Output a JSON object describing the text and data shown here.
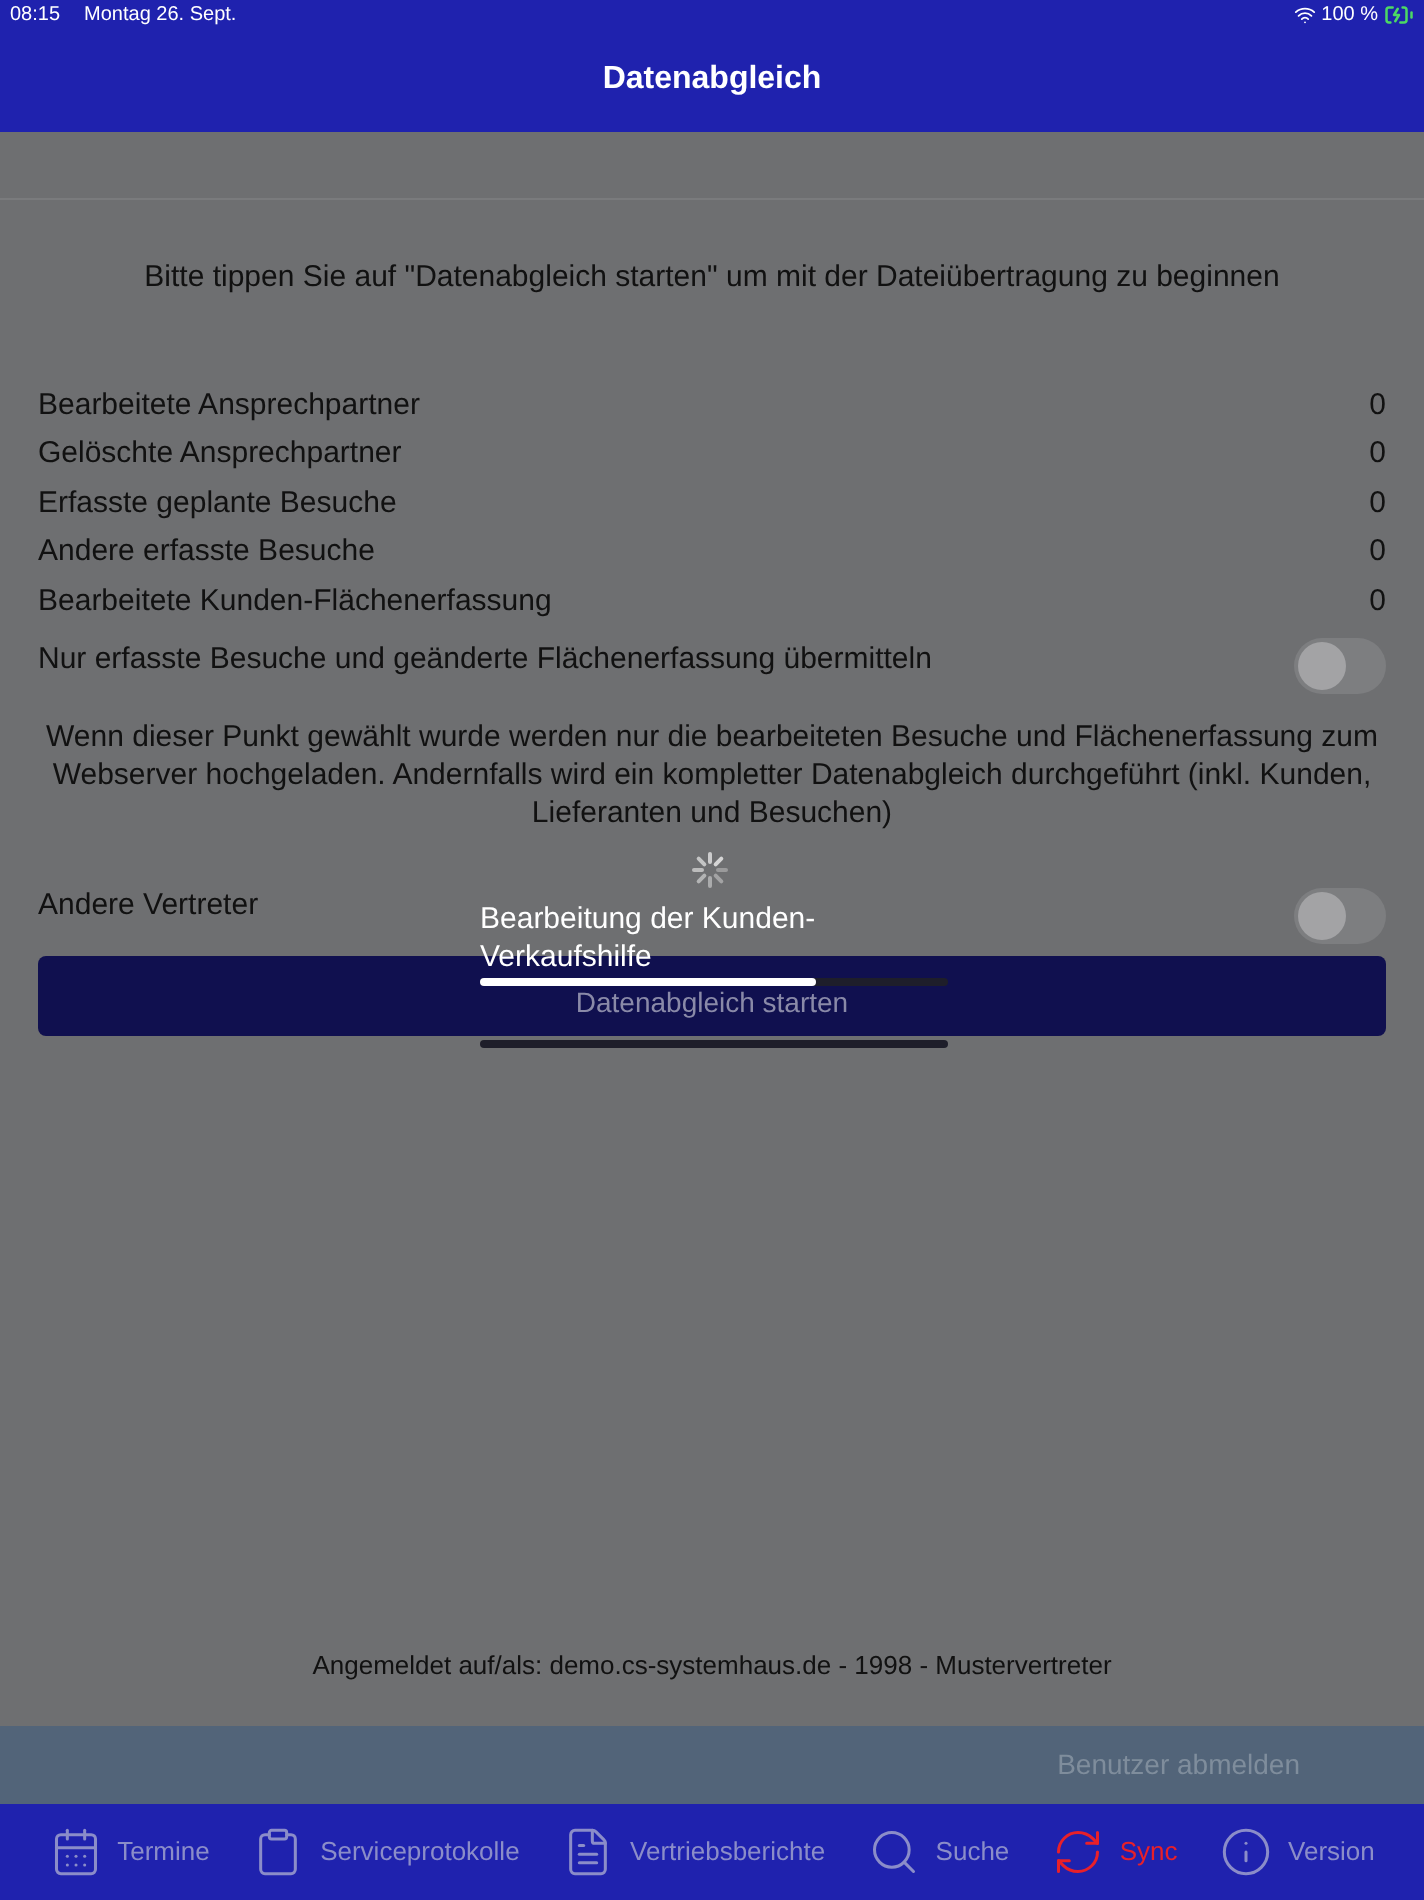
{
  "status_bar": {
    "time": "08:15",
    "date": "Montag 26. Sept.",
    "battery": "100 %"
  },
  "header": {
    "title": "Datenabgleich"
  },
  "instruction": "Bitte tippen Sie auf \"Datenabgleich starten\" um mit der Dateiübertragung zu beginnen",
  "counters": [
    {
      "label": "Bearbeitete Ansprechpartner",
      "value": "0"
    },
    {
      "label": "Gelöschte Ansprechpartner",
      "value": "0"
    },
    {
      "label": "Erfasste geplante Besuche",
      "value": "0"
    },
    {
      "label": "Andere erfasste Besuche",
      "value": "0"
    },
    {
      "label": "Bearbeitete Kunden-Flächenerfassung",
      "value": "0"
    }
  ],
  "only_changes": {
    "label": "Nur erfasste Besuche und geänderte Flächenerfassung übermitteln",
    "on": false
  },
  "explanation": "Wenn dieser Punkt gewählt wurde werden nur die bearbeiteten Besuche und Flächenerfassung zum Webserver hochgeladen. Andernfalls wird ein kompletter Datenabgleich durchgeführt (inkl. Kunden, Lieferanten und Besuchen)",
  "other_rep": {
    "label": "Andere Vertreter",
    "on": false
  },
  "start_button": "Datenabgleich starten",
  "progress": {
    "message": "Bearbeitung der Kunden-Verkaufshilfe",
    "level": 0.72
  },
  "login_info": "Angemeldet auf/als:  demo.cs-systemhaus.de - 1998 - Mustervertreter",
  "logout_button": "Benutzer abmelden",
  "tabs": [
    {
      "label": "Termine",
      "selected": false
    },
    {
      "label": "Serviceprotokolle",
      "selected": false
    },
    {
      "label": "Vertriebsberichte",
      "selected": false
    },
    {
      "label": "Suche",
      "selected": false
    },
    {
      "label": "Sync",
      "selected": true
    },
    {
      "label": "Version",
      "selected": false
    }
  ]
}
